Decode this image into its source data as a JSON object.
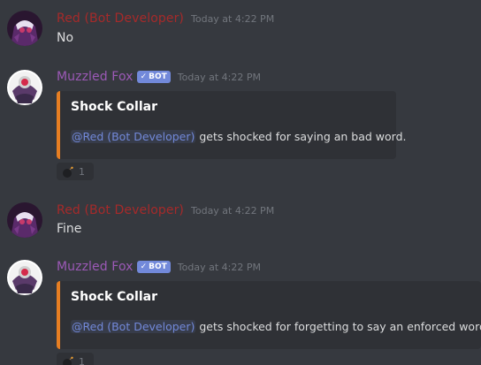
{
  "messages": [
    {
      "author": "Red (Bot Developer)",
      "timestamp": "Today at 4:22 PM",
      "text": "No"
    },
    {
      "author": "Muzzled Fox",
      "bot_tag": "BOT",
      "timestamp": "Today at 4:22 PM",
      "embed": {
        "title": "Shock Collar",
        "mention": "@Red (Bot Developer)",
        "description": "gets shocked for saying an bad word.",
        "accent_color": "#e67e22"
      },
      "reaction": {
        "icon": "bomb-icon",
        "count": "1"
      }
    },
    {
      "author": "Red (Bot Developer)",
      "timestamp": "Today at 4:22 PM",
      "text": "Fine"
    },
    {
      "author": "Muzzled Fox",
      "bot_tag": "BOT",
      "timestamp": "Today at 4:22 PM",
      "embed": {
        "title": "Shock Collar",
        "mention": "@Red (Bot Developer)",
        "description": "gets shocked for forgetting to say an enforced words.",
        "accent_color": "#e67e22"
      },
      "reaction": {
        "icon": "bomb-icon",
        "count": "1"
      }
    }
  ],
  "colors": {
    "background": "#36393f",
    "embed_background": "#2f3136",
    "red_user": "#a62a2a",
    "bot_user": "#9b59b6",
    "bot_tag": "#7289da",
    "mention": "#7289da"
  }
}
